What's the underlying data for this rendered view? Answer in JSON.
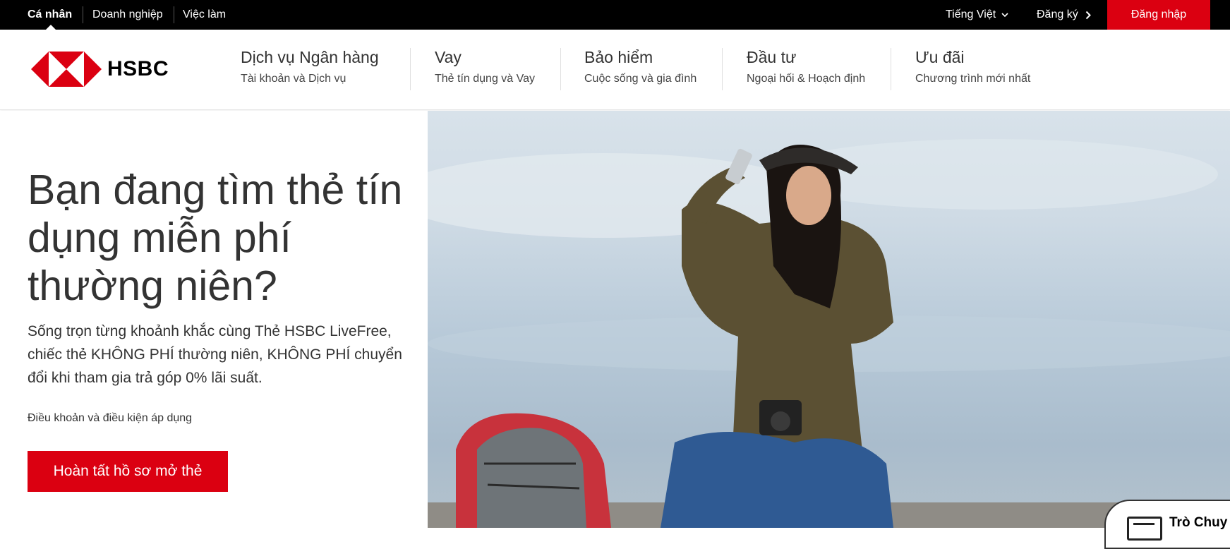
{
  "topbar": {
    "segments": [
      "Cá nhân",
      "Doanh nghiệp",
      "Việc làm"
    ],
    "language": "Tiếng Việt",
    "register": "Đăng ký",
    "login": "Đăng nhập"
  },
  "brand": {
    "name": "HSBC",
    "color": "#db0011"
  },
  "nav": [
    {
      "title": "Dịch vụ Ngân hàng",
      "sub": "Tài khoản và Dịch vụ"
    },
    {
      "title": "Vay",
      "sub": "Thẻ tín dụng và Vay"
    },
    {
      "title": "Bảo hiểm",
      "sub": "Cuộc sống và gia đình"
    },
    {
      "title": "Đầu tư",
      "sub": "Ngoại hối & Hoạch định"
    },
    {
      "title": "Ưu đãi",
      "sub": "Chương trình mới nhất"
    }
  ],
  "hero": {
    "title": "Bạn đang tìm thẻ tín dụng miễn phí thường niên?",
    "description": "Sống trọn từng khoảnh khắc cùng Thẻ HSBC LiveFree, chiếc thẻ KHÔNG PHÍ thường niên, KHÔNG PHÍ chuyển đổi khi tham gia trả góp 0% lãi suất.",
    "terms": "Điều khoản và điều kiện áp dụng",
    "cta": "Hoàn tất hồ sơ mở thẻ"
  },
  "chat": {
    "label": "Trò Chuy"
  },
  "icons": [
    "hsbc-logo-icon",
    "chevron-down-icon",
    "chevron-right-icon",
    "chat-icon"
  ]
}
